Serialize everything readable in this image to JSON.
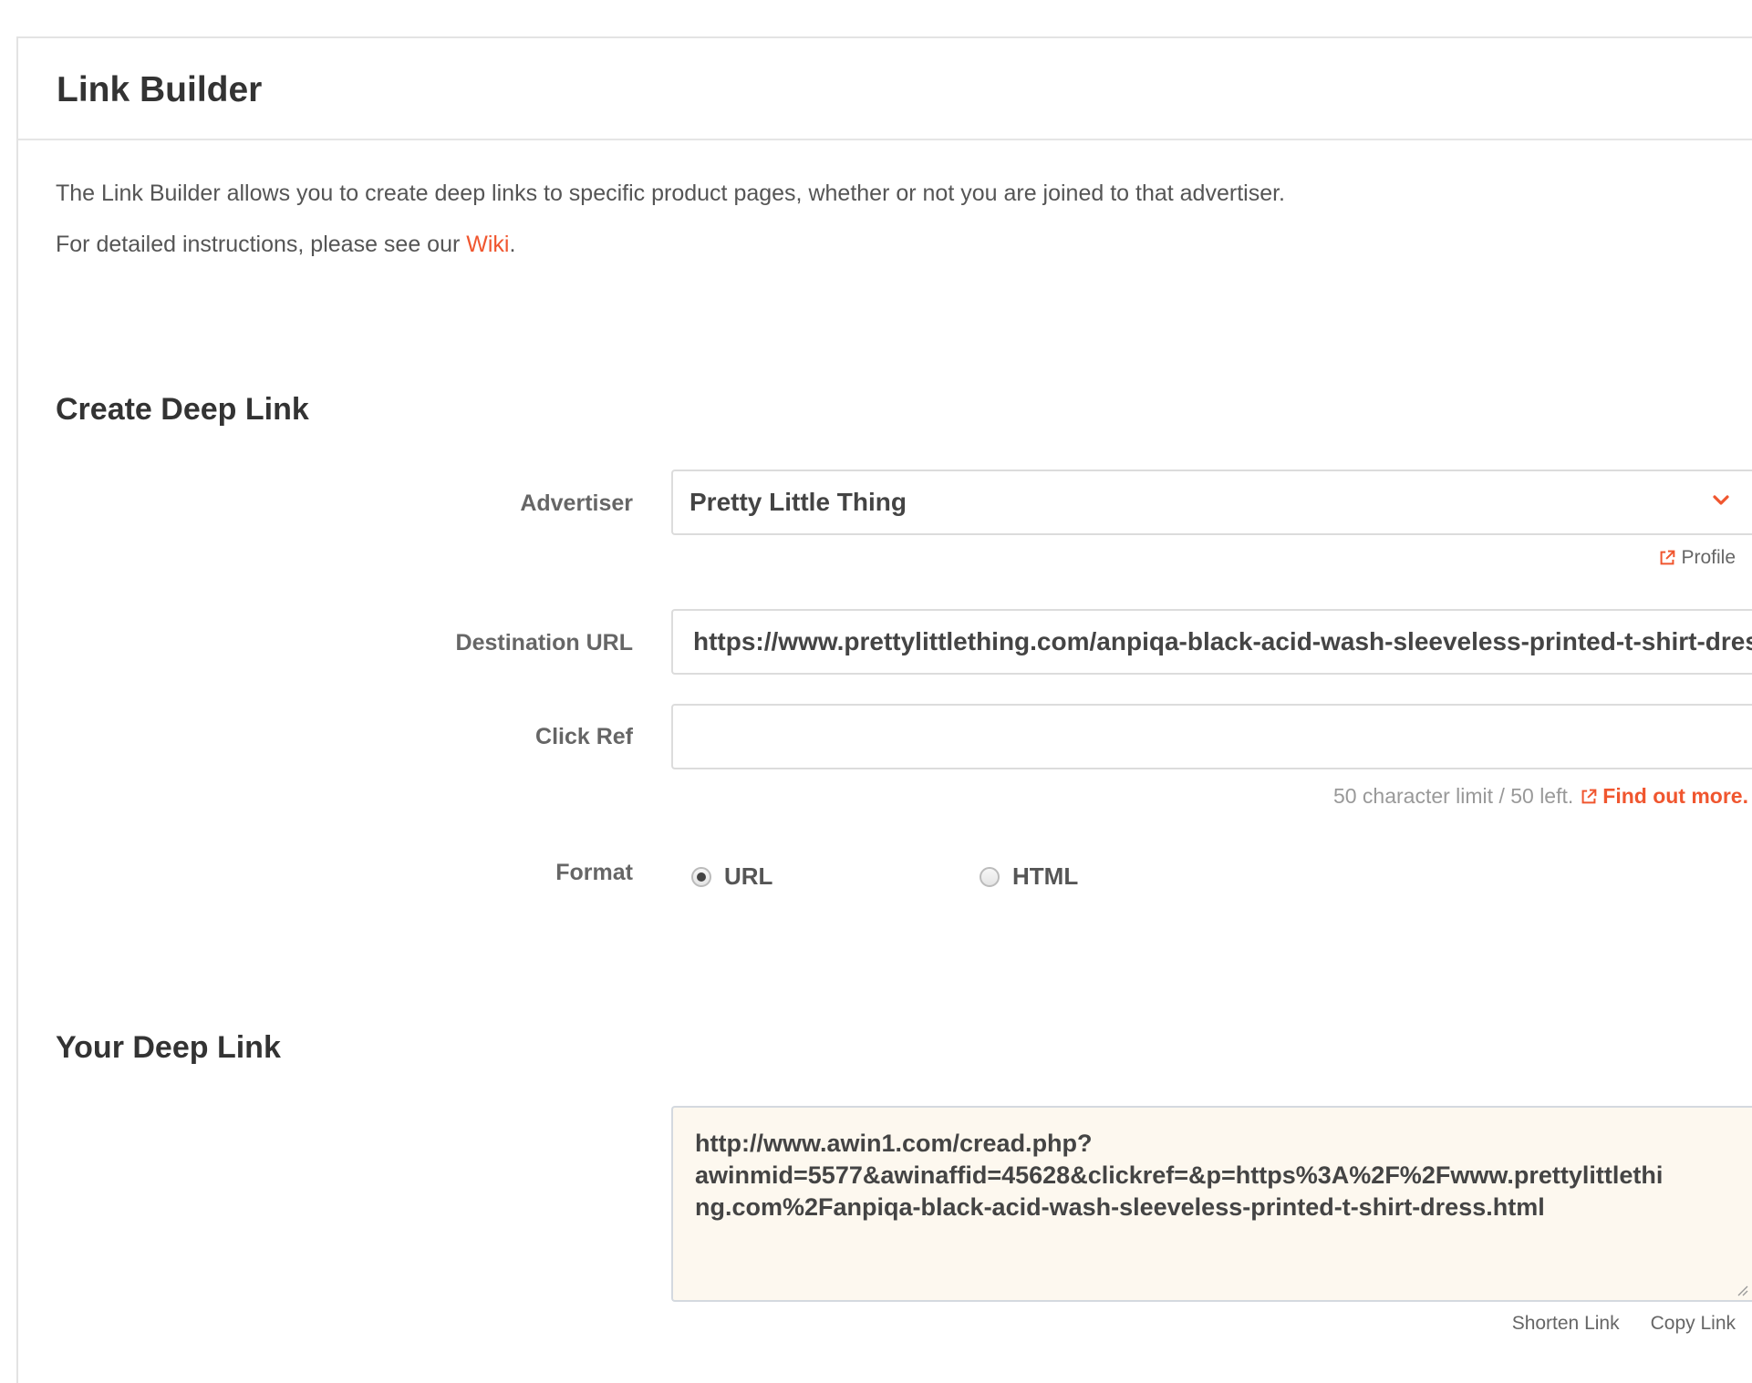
{
  "panel": {
    "title": "Link Builder"
  },
  "intro": {
    "line1": "The Link Builder allows you to create deep links to specific product pages, whether or not you are joined to that advertiser.",
    "line2_prefix": "For detailed instructions, please see our ",
    "wiki_label": "Wiki",
    "line2_suffix": "."
  },
  "create_section": {
    "title": "Create Deep Link",
    "advertiser": {
      "label": "Advertiser",
      "selected": "Pretty Little Thing",
      "profile_label": "Profile"
    },
    "destination_url": {
      "label": "Destination URL",
      "value": "https://www.prettylittlething.com/anpiqa-black-acid-wash-sleeveless-printed-t-shirt-dress.html"
    },
    "click_ref": {
      "label": "Click Ref",
      "value": "",
      "hint": "50 character limit / 50 left.",
      "find_out_more": "Find out more."
    },
    "format": {
      "label": "Format",
      "options": [
        {
          "label": "URL",
          "checked": true
        },
        {
          "label": "HTML",
          "checked": false
        }
      ]
    }
  },
  "your_section": {
    "title": "Your Deep Link",
    "link_value": "http://www.awin1.com/cread.php?\nawinmid=5577&awinaffid=45628&clickref=&p=https%3A%2F%2Fwww.prettylittlethi\nng.com%2Fanpiqa-black-acid-wash-sleeveless-printed-t-shirt-dress.html",
    "shorten_label": "Shorten Link",
    "copy_label": "Copy Link"
  },
  "colors": {
    "accent": "#f0562f",
    "deep_link_bg": "#fdf8ef"
  }
}
